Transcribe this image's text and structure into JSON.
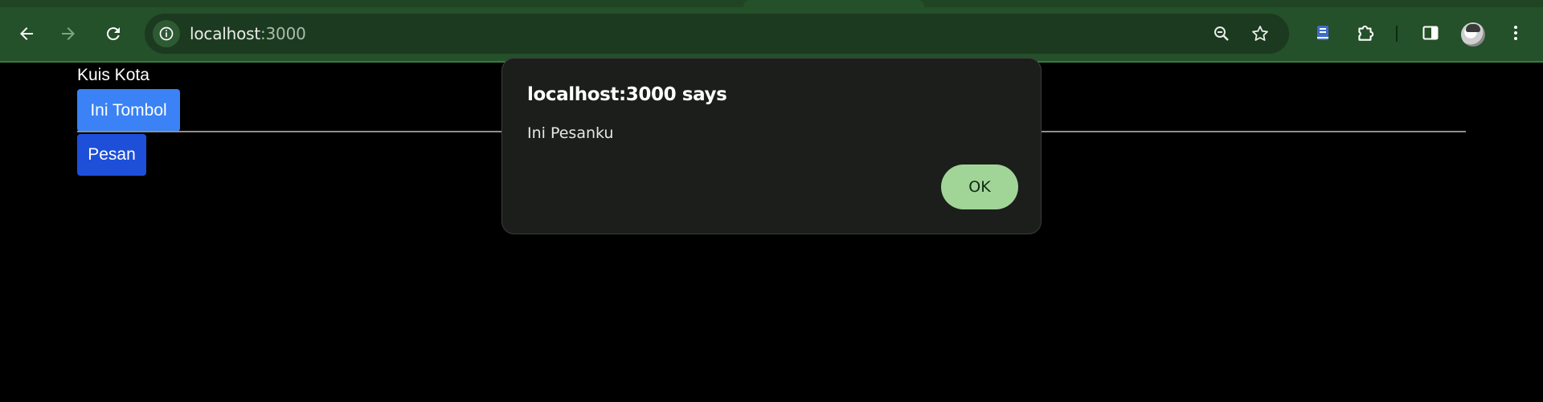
{
  "browser": {
    "url_host": "localhost",
    "url_port": ":3000",
    "icons": {
      "back": "arrow-left-icon",
      "forward": "arrow-right-icon",
      "reload": "reload-icon",
      "site_info": "info-icon",
      "zoom": "zoom-out-icon",
      "bookmark": "star-icon",
      "extension_reader": "book-icon",
      "extensions": "puzzle-icon",
      "side_panel": "side-panel-icon",
      "profile": "avatar",
      "menu": "kebab-menu-icon"
    },
    "colors": {
      "toolbar": "#24502a",
      "omnibox": "#1c3a20"
    }
  },
  "page": {
    "title": "Kuis Kota",
    "primary_button": "Ini Tombol",
    "secondary_button": "Pesan",
    "colors": {
      "background": "#000000",
      "primary_button": "#3a82f5",
      "secondary_button": "#1d4fd9"
    }
  },
  "dialog": {
    "title": "localhost:3000 says",
    "message": "Ini Pesanku",
    "ok_label": "OK",
    "colors": {
      "background": "#1b1e1b",
      "ok_button": "#a1d598"
    }
  }
}
